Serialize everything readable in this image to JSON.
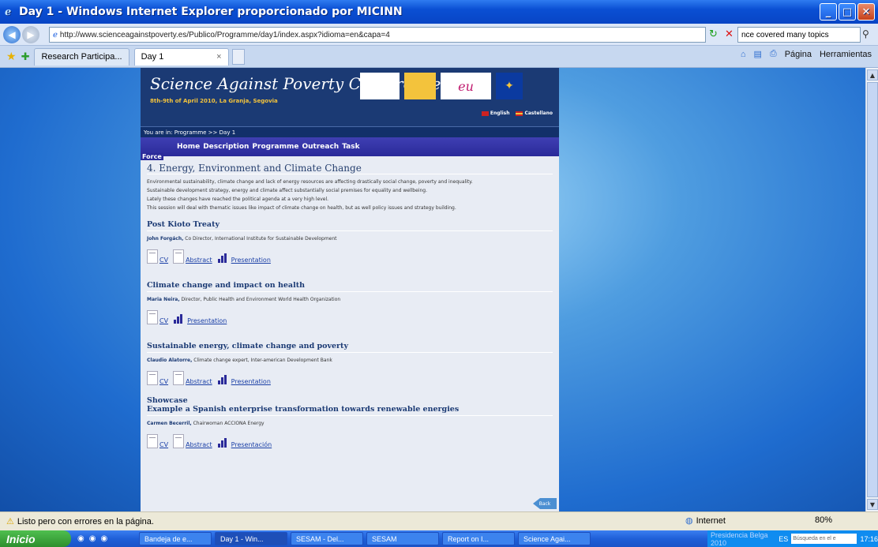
{
  "window": {
    "title": "Day 1 - Windows Internet Explorer proporcionado por MICINN"
  },
  "address": {
    "url": "http://www.scienceagainstpoverty.es/Publico/Programme/day1/index.aspx?idioma=en&capa=4",
    "search_value": "nce covered many topics"
  },
  "tabs": [
    {
      "label": "Research Participa..."
    },
    {
      "label": "Day 1"
    }
  ],
  "commands": {
    "page": "Página",
    "tools": "Herramientas"
  },
  "site": {
    "title": "Science Against Poverty Conference",
    "subtitle": "8th-9th of April 2010, La Granja, Segovia",
    "logo_eu": "eu",
    "lang_en": "English",
    "lang_es": "Castellano",
    "breadcrumb": "You are in: Programme >> Day 1",
    "menu": [
      "Home",
      "Description",
      "Programme",
      "Outreach",
      "Task"
    ],
    "force": "Force"
  },
  "section": {
    "title": "4. Energy, Environment and Climate Change",
    "paragraphs": [
      "Environmental sustainability, climate change and lack of energy resources are affecting drastically social change, poverty and inequality.",
      "Sustainable development strategy, energy and climate affect substantially social premises for equality and wellbeing.",
      "Lately these changes have reached the political agenda at a very high level.",
      "This session will deal with thematic issues like impact of climate change on health, but as well policy issues and strategy building."
    ]
  },
  "talks": [
    {
      "title": "Post Kioto Treaty",
      "speaker": "John Forgách,",
      "role": " Co Director, International Institute for Sustainable Development",
      "cv": "CV",
      "abstract": "Abstract",
      "presentation": "Presentation"
    },
    {
      "title": "Climate change and impact on health",
      "speaker": "Maria Neira,",
      "role": " Director, Public Health and Environment World Health Organization",
      "cv": "CV",
      "presentation": "Presentation"
    },
    {
      "title": "Sustainable energy, climate change and poverty",
      "speaker": "Claudio Alatorre,",
      "role": " Climate change expert, Inter-american Development Bank",
      "cv": "CV",
      "abstract": "Abstract",
      "presentation": "Presentation"
    },
    {
      "kicker": "Showcase",
      "title": "Example a Spanish enterprise transformation towards renewable energies",
      "speaker": "Carmen Becerril,",
      "role": " Chairwoman ACCIONA Energy",
      "cv": "CV",
      "abstract": "Abstract",
      "presentation": "Presentación"
    }
  ],
  "back_label": "Back",
  "status": {
    "text": "Listo pero con errores en la página.",
    "zone": "Internet",
    "zoom": "80%"
  },
  "taskbar": {
    "start": "Inicio",
    "tasks": [
      "Bandeja de e...",
      "Day 1 - Win...",
      "SESAM - Del...",
      "SESAM",
      "Report on I...",
      "Science Agai..."
    ],
    "tray_text": "Presidencia Belga 2010",
    "tray_search": "Búsqueda en el e",
    "lang": "ES",
    "clock": "17:16"
  }
}
